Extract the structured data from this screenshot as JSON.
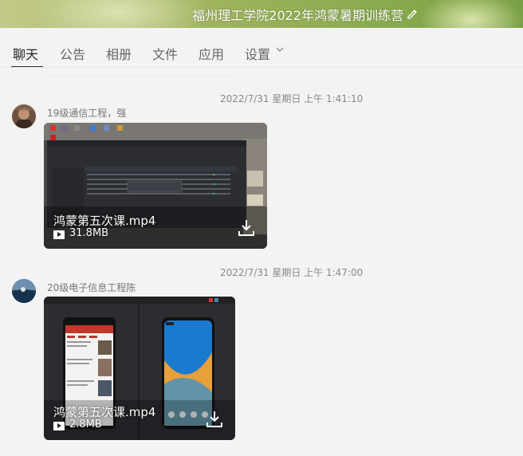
{
  "window": {
    "title": "福州理工学院2022年鸿蒙暑期训练营"
  },
  "tabs": [
    {
      "label": "聊天",
      "active": true
    },
    {
      "label": "公告"
    },
    {
      "label": "相册"
    },
    {
      "label": "文件"
    },
    {
      "label": "应用"
    },
    {
      "label": "设置"
    }
  ],
  "messages": [
    {
      "timestamp": "2022/7/31 星期日 上午 1:41:10",
      "sender": "19级通信工程，强",
      "file": {
        "name": "鸿蒙第五次课.mp4",
        "size": "31.8MB"
      }
    },
    {
      "timestamp": "2022/7/31 星期日 上午 1:47:00",
      "sender": "20级电子信息工程陈",
      "file": {
        "name": "鸿蒙第五次课.mp4",
        "size": "2.8MB"
      }
    }
  ],
  "colors": {
    "title_bar": "#8bac4e",
    "background": "#f3f3f3",
    "active_tab": "#222222"
  }
}
